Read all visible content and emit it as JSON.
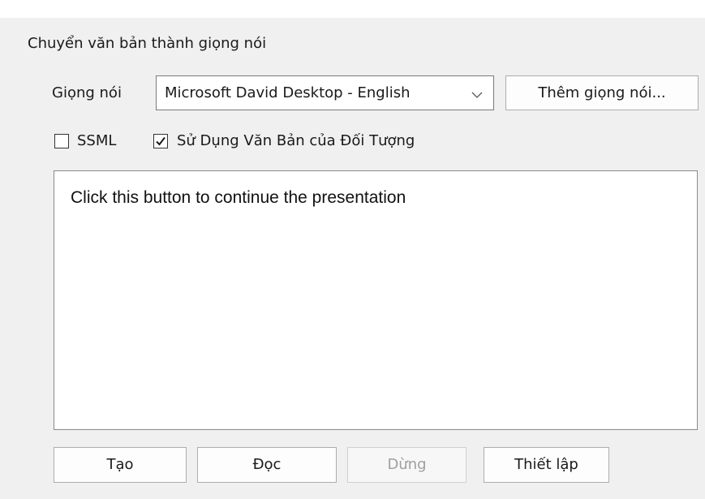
{
  "section": {
    "title": "Chuyển văn bản thành giọng nói"
  },
  "voice": {
    "label": "Giọng nói",
    "selected": "Microsoft David Desktop - English",
    "dropdown_icon": "chevron-down-icon",
    "add_button_label": "Thêm giọng nói..."
  },
  "options": {
    "ssml": {
      "label": "SSML",
      "checked": false
    },
    "use_object_text": {
      "label": "Sử Dụng Văn Bản của Đối Tượng",
      "checked": true
    }
  },
  "text_input": {
    "value": "Click this button to continue the presentation"
  },
  "actions": {
    "create_label": "Tạo",
    "read_label": "Đọc",
    "stop_label": "Dừng",
    "settings_label": "Thiết lập"
  }
}
